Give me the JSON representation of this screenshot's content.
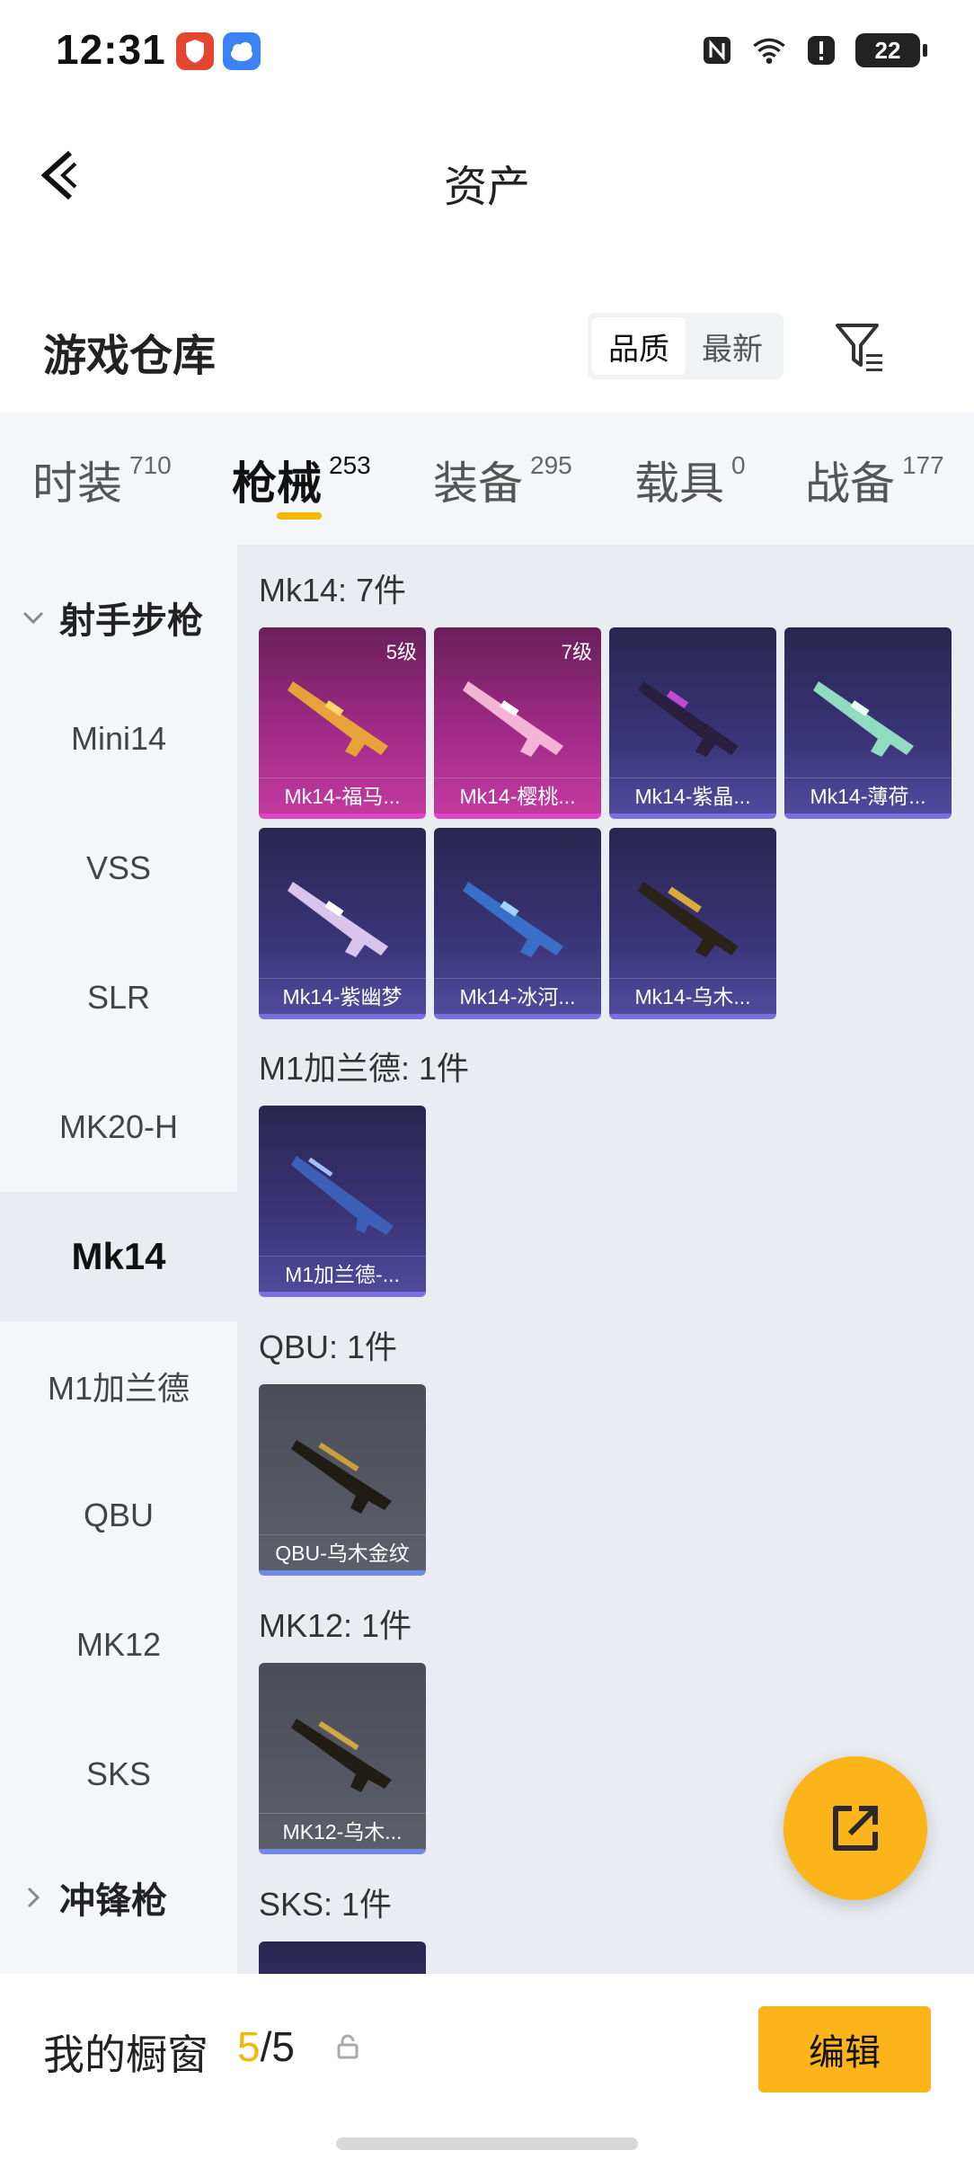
{
  "status_bar": {
    "time": "12:31",
    "battery": "22"
  },
  "header": {
    "title": "资产"
  },
  "warehouse": {
    "title": "游戏仓库",
    "sort_options": [
      "品质",
      "最新"
    ]
  },
  "tabs": [
    {
      "label": "时装",
      "count": "710"
    },
    {
      "label": "枪械",
      "count": "253"
    },
    {
      "label": "装备",
      "count": "295"
    },
    {
      "label": "载具",
      "count": "0"
    },
    {
      "label": "战备",
      "count": "177"
    }
  ],
  "sidebar": {
    "category_top": "射手步枪",
    "items": [
      "Mini14",
      "VSS",
      "SLR",
      "MK20-H",
      "Mk14",
      "M1加兰德",
      "QBU",
      "MK12",
      "SKS"
    ],
    "category_bottom": "冲锋枪"
  },
  "groups": [
    {
      "title": "Mk14: 7件",
      "items": [
        {
          "label": "Mk14-福马...",
          "level": "5级",
          "rarity": "pink"
        },
        {
          "label": "Mk14-樱桃...",
          "level": "7级",
          "rarity": "pink"
        },
        {
          "label": "Mk14-紫晶...",
          "rarity": "purple"
        },
        {
          "label": "Mk14-薄荷...",
          "rarity": "purple"
        },
        {
          "label": "Mk14-紫幽梦",
          "rarity": "purple"
        },
        {
          "label": "Mk14-冰河...",
          "rarity": "purple"
        },
        {
          "label": "Mk14-乌木...",
          "rarity": "purple"
        }
      ]
    },
    {
      "title": "M1加兰德: 1件",
      "items": [
        {
          "label": "M1加兰德-...",
          "rarity": "purple"
        }
      ]
    },
    {
      "title": "QBU: 1件",
      "items": [
        {
          "label": "QBU-乌木金纹",
          "rarity": "gray"
        }
      ]
    },
    {
      "title": "MK12: 1件",
      "items": [
        {
          "label": "MK12-乌木...",
          "rarity": "gray"
        }
      ]
    },
    {
      "title": "SKS: 1件",
      "items": []
    }
  ],
  "showcase": {
    "label": "我的橱窗",
    "current": "5",
    "total": "/5"
  },
  "edit_button": "编辑",
  "colors": {
    "accent": "#f5b800",
    "fab": "#fbb51b",
    "pink_rarity": "#e145c6",
    "purple_rarity": "#7a6ee0"
  }
}
